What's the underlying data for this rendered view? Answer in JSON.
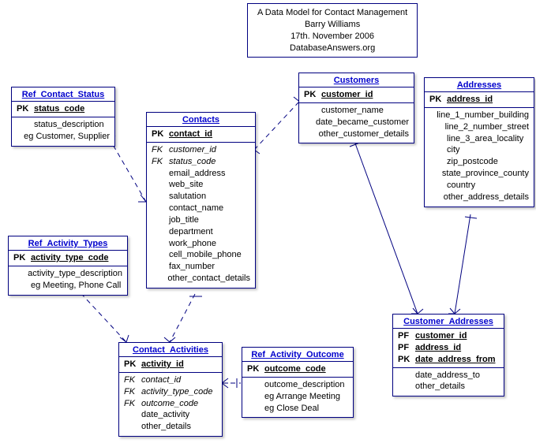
{
  "title": {
    "line1": "A Data Model for Contact Management",
    "line2": "Barry Williams",
    "line3": "17th. November 2006",
    "line4": "DatabaseAnswers.org"
  },
  "entities": {
    "ref_contact_status": {
      "name": "Ref_Contact_Status",
      "rows": [
        {
          "key": "PK",
          "keytype": "pk",
          "attr": "status_code",
          "attrtype": "pk"
        },
        {
          "key": "",
          "keytype": "",
          "attr": "status_description",
          "attrtype": ""
        },
        {
          "key": "",
          "keytype": "",
          "attr": "eg Customer, Supplier",
          "attrtype": ""
        }
      ]
    },
    "contacts": {
      "name": "Contacts",
      "rows": [
        {
          "key": "PK",
          "keytype": "pk",
          "attr": "contact_id",
          "attrtype": "pk"
        },
        {
          "key": "FK",
          "keytype": "fk",
          "attr": "customer_id",
          "attrtype": "fk"
        },
        {
          "key": "FK",
          "keytype": "fk",
          "attr": "status_code",
          "attrtype": "fk"
        },
        {
          "key": "",
          "keytype": "",
          "attr": "email_address",
          "attrtype": ""
        },
        {
          "key": "",
          "keytype": "",
          "attr": "web_site",
          "attrtype": ""
        },
        {
          "key": "",
          "keytype": "",
          "attr": "salutation",
          "attrtype": ""
        },
        {
          "key": "",
          "keytype": "",
          "attr": "contact_name",
          "attrtype": ""
        },
        {
          "key": "",
          "keytype": "",
          "attr": "job_title",
          "attrtype": ""
        },
        {
          "key": "",
          "keytype": "",
          "attr": "department",
          "attrtype": ""
        },
        {
          "key": "",
          "keytype": "",
          "attr": "work_phone",
          "attrtype": ""
        },
        {
          "key": "",
          "keytype": "",
          "attr": "cell_mobile_phone",
          "attrtype": ""
        },
        {
          "key": "",
          "keytype": "",
          "attr": "fax_number",
          "attrtype": ""
        },
        {
          "key": "",
          "keytype": "",
          "attr": "other_contact_details",
          "attrtype": ""
        }
      ]
    },
    "customers": {
      "name": "Customers",
      "rows": [
        {
          "key": "PK",
          "keytype": "pk",
          "attr": "customer_id",
          "attrtype": "pk"
        },
        {
          "key": "",
          "keytype": "",
          "attr": "customer_name",
          "attrtype": ""
        },
        {
          "key": "",
          "keytype": "",
          "attr": "date_became_customer",
          "attrtype": ""
        },
        {
          "key": "",
          "keytype": "",
          "attr": "other_customer_details",
          "attrtype": ""
        }
      ]
    },
    "addresses": {
      "name": "Addresses",
      "rows": [
        {
          "key": "PK",
          "keytype": "pk",
          "attr": "address_id",
          "attrtype": "pk"
        },
        {
          "key": "",
          "keytype": "",
          "attr": "line_1_number_building",
          "attrtype": ""
        },
        {
          "key": "",
          "keytype": "",
          "attr": "line_2_number_street",
          "attrtype": ""
        },
        {
          "key": "",
          "keytype": "",
          "attr": "line_3_area_locality",
          "attrtype": ""
        },
        {
          "key": "",
          "keytype": "",
          "attr": "city",
          "attrtype": ""
        },
        {
          "key": "",
          "keytype": "",
          "attr": "zip_postcode",
          "attrtype": ""
        },
        {
          "key": "",
          "keytype": "",
          "attr": "state_province_county",
          "attrtype": ""
        },
        {
          "key": "",
          "keytype": "",
          "attr": "country",
          "attrtype": ""
        },
        {
          "key": "",
          "keytype": "",
          "attr": "other_address_details",
          "attrtype": ""
        }
      ]
    },
    "ref_activity_types": {
      "name": "Ref_Activity_Types",
      "rows": [
        {
          "key": "PK",
          "keytype": "pk",
          "attr": "activity_type_code",
          "attrtype": "pk"
        },
        {
          "key": "",
          "keytype": "",
          "attr": "activity_type_description",
          "attrtype": ""
        },
        {
          "key": "",
          "keytype": "",
          "attr": "eg Meeting, Phone Call",
          "attrtype": ""
        }
      ]
    },
    "contact_activities": {
      "name": "Contact_Activities",
      "rows": [
        {
          "key": "PK",
          "keytype": "pk",
          "attr": "activity_id",
          "attrtype": "pk"
        },
        {
          "key": "FK",
          "keytype": "fk",
          "attr": "contact_id",
          "attrtype": "fk"
        },
        {
          "key": "FK",
          "keytype": "fk",
          "attr": "activity_type_code",
          "attrtype": "fk"
        },
        {
          "key": "FK",
          "keytype": "fk",
          "attr": "outcome_code",
          "attrtype": "fk"
        },
        {
          "key": "",
          "keytype": "",
          "attr": "date_activity",
          "attrtype": ""
        },
        {
          "key": "",
          "keytype": "",
          "attr": "other_details",
          "attrtype": ""
        }
      ]
    },
    "ref_activity_outcome": {
      "name": "Ref_Activity_Outcome",
      "rows": [
        {
          "key": "PK",
          "keytype": "pk",
          "attr": "outcome_code",
          "attrtype": "pk"
        },
        {
          "key": "",
          "keytype": "",
          "attr": "outcome_description",
          "attrtype": ""
        },
        {
          "key": "",
          "keytype": "",
          "attr": "eg Arrange Meeting",
          "attrtype": ""
        },
        {
          "key": "",
          "keytype": "",
          "attr": "eg Close Deal",
          "attrtype": ""
        }
      ]
    },
    "customer_addresses": {
      "name": "Customer_Addresses",
      "rows": [
        {
          "key": "PF",
          "keytype": "pk",
          "attr": "customer_id",
          "attrtype": "pk"
        },
        {
          "key": "PF",
          "keytype": "pk",
          "attr": "address_id",
          "attrtype": "pk"
        },
        {
          "key": "PK",
          "keytype": "pk",
          "attr": "date_address_from",
          "attrtype": "pk"
        },
        {
          "key": "",
          "keytype": "",
          "attr": "date_address_to",
          "attrtype": ""
        },
        {
          "key": "",
          "keytype": "",
          "attr": "other_details",
          "attrtype": ""
        }
      ]
    }
  }
}
